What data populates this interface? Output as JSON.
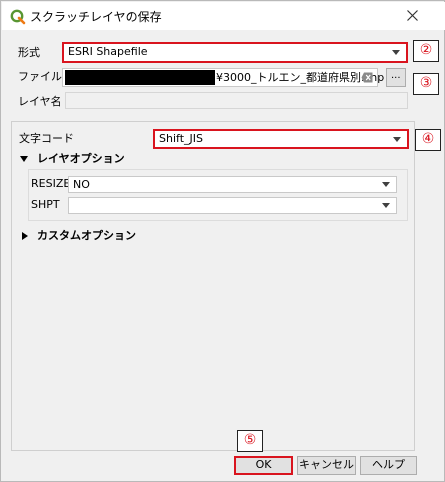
{
  "window": {
    "title": "スクラッチレイヤの保存"
  },
  "form": {
    "format_label": "形式",
    "format_value": "ESRI Shapefile",
    "filename_label": "ファイル名",
    "filename_value": "¥3000_トルエン_都道府県別.shp",
    "browse_label": "...",
    "layername_label": "レイヤ名",
    "layername_value": "",
    "encoding_label": "文字コード",
    "encoding_value": "Shift_JIS"
  },
  "layer_options": {
    "title": "レイヤオプション",
    "resize_label": "RESIZE",
    "resize_value": "NO",
    "shpt_label": "SHPT",
    "shpt_value": ""
  },
  "custom_options": {
    "title": "カスタムオプション"
  },
  "buttons": {
    "ok": "OK",
    "cancel": "キャンセル",
    "help": "ヘルプ"
  },
  "annotations": {
    "n2": "②",
    "n3": "③",
    "n4": "④",
    "n5": "⑤"
  },
  "colors": {
    "annotation_red": "#d9141e",
    "qgis_green": "#589632",
    "qgis_yellow": "#ee7913"
  },
  "icons": [
    "qgis-logo-icon",
    "close-icon",
    "clear-field-icon",
    "chevron-down-icon",
    "expand-triangle-icon",
    "collapse-triangle-icon"
  ]
}
